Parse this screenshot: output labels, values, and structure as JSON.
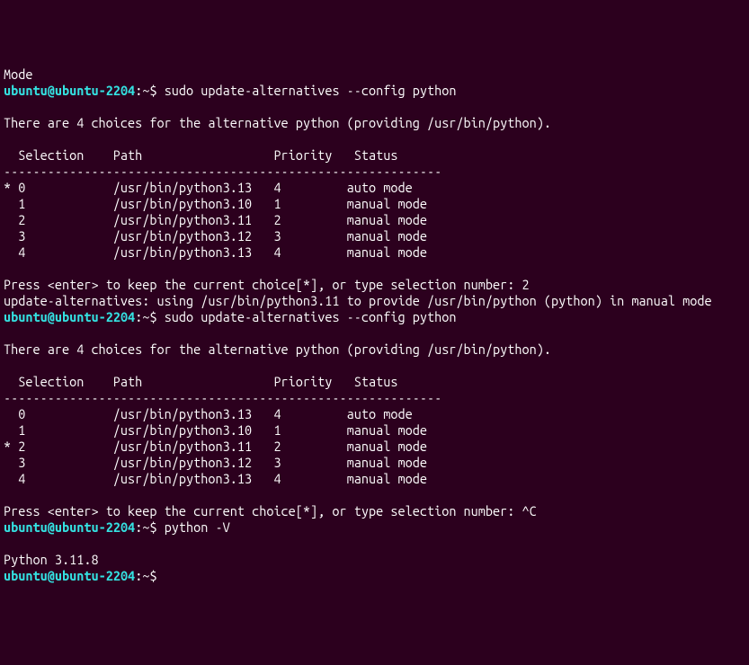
{
  "partial_top": "Mode",
  "prompt": {
    "user": "ubuntu",
    "at": "@",
    "host": "ubuntu-2204",
    "colon": ":",
    "path": "~",
    "dollar": "$"
  },
  "block1": {
    "command": "sudo update-alternatives --config python",
    "intro": "There are 4 choices for the alternative python (providing /usr/bin/python).",
    "header": "  Selection    Path                  Priority   Status",
    "divider": "------------------------------------------------------------",
    "rows": [
      "* 0            /usr/bin/python3.13   4         auto mode",
      "  1            /usr/bin/python3.10   1         manual mode",
      "  2            /usr/bin/python3.11   2         manual mode",
      "  3            /usr/bin/python3.12   3         manual mode",
      "  4            /usr/bin/python3.13   4         manual mode"
    ],
    "press": "Press <enter> to keep the current choice[*], or type selection number: 2",
    "result": "update-alternatives: using /usr/bin/python3.11 to provide /usr/bin/python (python) in manual mode"
  },
  "block2": {
    "command": "sudo update-alternatives --config python",
    "intro": "There are 4 choices for the alternative python (providing /usr/bin/python).",
    "header": "  Selection    Path                  Priority   Status",
    "divider": "------------------------------------------------------------",
    "rows": [
      "  0            /usr/bin/python3.13   4         auto mode",
      "  1            /usr/bin/python3.10   1         manual mode",
      "* 2            /usr/bin/python3.11   2         manual mode",
      "  3            /usr/bin/python3.12   3         manual mode",
      "  4            /usr/bin/python3.13   4         manual mode"
    ],
    "press": "Press <enter> to keep the current choice[*], or type selection number: ^C"
  },
  "block3": {
    "command": "python -V",
    "output": "Python 3.11.8"
  },
  "empty_prompt_cmd": ""
}
